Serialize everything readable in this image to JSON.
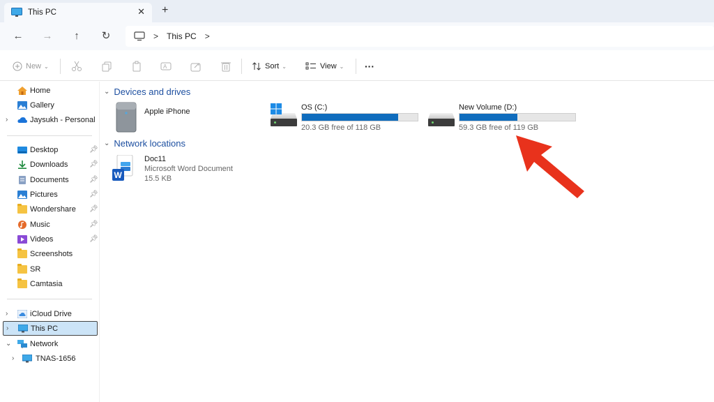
{
  "tab": {
    "title": "This PC",
    "close": "✕",
    "new_tab": "+"
  },
  "nav": {
    "back": "←",
    "forward": "→",
    "up": "↑",
    "refresh": "↻"
  },
  "address": {
    "crumb": "This PC",
    "sep": ">",
    "more": ">"
  },
  "toolbar": {
    "new_label": "New",
    "sort_label": "Sort",
    "view_label": "View",
    "more_label": "···"
  },
  "sidebar": {
    "items": [
      {
        "label": "Home"
      },
      {
        "label": "Gallery"
      },
      {
        "label": "Jaysukh - Personal"
      },
      {
        "label": "Desktop"
      },
      {
        "label": "Downloads"
      },
      {
        "label": "Documents"
      },
      {
        "label": "Pictures"
      },
      {
        "label": "Wondershare"
      },
      {
        "label": "Music"
      },
      {
        "label": "Videos"
      },
      {
        "label": "Screenshots"
      },
      {
        "label": "SR"
      },
      {
        "label": "Camtasia"
      },
      {
        "label": "iCloud Drive"
      },
      {
        "label": "This PC"
      },
      {
        "label": "Network"
      },
      {
        "label": "TNAS-1656"
      }
    ]
  },
  "sections": {
    "devices": "Devices and drives",
    "network": "Network locations"
  },
  "devices": {
    "iphone": {
      "name": "Apple iPhone"
    },
    "c_drive": {
      "name": "OS (C:)",
      "free": "20.3 GB free of 118 GB",
      "used_fraction": 0.83
    },
    "d_drive": {
      "name": "New Volume (D:)",
      "free": "59.3 GB free of 119 GB",
      "used_fraction": 0.5
    }
  },
  "network_items": {
    "doc": {
      "name": "Doc11",
      "type": "Microsoft Word Document",
      "size": "15.5 KB"
    }
  },
  "colors": {
    "accent": "#0f6cbd",
    "arrow": "#e8321c",
    "section": "#1d4fa0",
    "selection": "#cce4f7"
  }
}
